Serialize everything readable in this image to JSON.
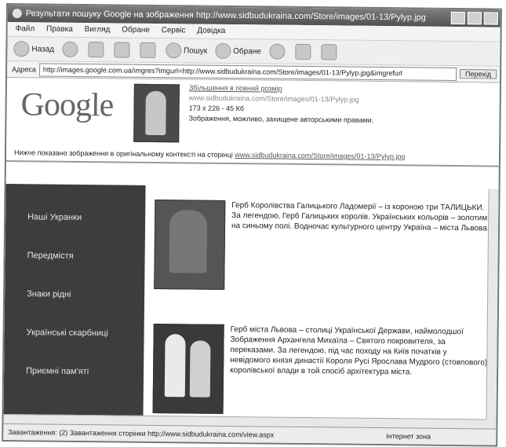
{
  "window": {
    "title": "Результати пошуку Google на зображення http://www.sidbudukraina.com/Store/images/01-13/Pylyp.jpg"
  },
  "menu": [
    "Файл",
    "Правка",
    "Вигляд",
    "Обране",
    "Сервіс",
    "Довідка"
  ],
  "toolbar": {
    "back": "Назад",
    "search": "Пошук",
    "favorites": "Обране"
  },
  "address": {
    "label": "Адреса",
    "url": "http://images.google.com.ua/imgres?imgurl=http://www.sidbudukraina.com/Store/images/01-13/Pylyp.jpg&imgrefurl",
    "go": "Перехід"
  },
  "google": {
    "logo": "Google",
    "link": "Збільшення в повний розмір",
    "url": "www.sidbudukraina.com/Store/images/01-13/Pylyp.jpg",
    "size": "173 x 226 - 45 Кб",
    "note": "Зображення, можливо, захищене авторськими правами.",
    "below_prefix": "Нижче показано зображення в оригінальному контексті на сторінці",
    "below_link": "www.sidbudukraina.com/Store/images/01-13/Pylyp.jpg"
  },
  "nav": [
    "Наші Укранки",
    "Передмістя",
    "Знаки рідні",
    "Українські скарбниці",
    "Приємні пам'яті"
  ],
  "content": {
    "p1": "Герб Королівства Галицького Ладомерії – із короною три ТАЛИЦЬКИ. За легендою, Герб Галицьких королів. Українських кольорів – золотим на синьому полі. Водночас культурного центру Україна – міста Львова.",
    "p2": "Герб міста Львова – столиці Української Держави, наймолодшої Зображення Архангела Михаїла – Святого покровителя, за переказами. За легендою, під час походу на Київ початків у невідомого князя династії Короля Русі Ярослава Мудрого (стовпового) королівської влади в той спосіб архітектура міста."
  },
  "status": {
    "text": "Завантаження: (2) Завантаження сторінки http://www.sidbudukraina.com/view.aspx",
    "zone": "Інтернет зона"
  }
}
